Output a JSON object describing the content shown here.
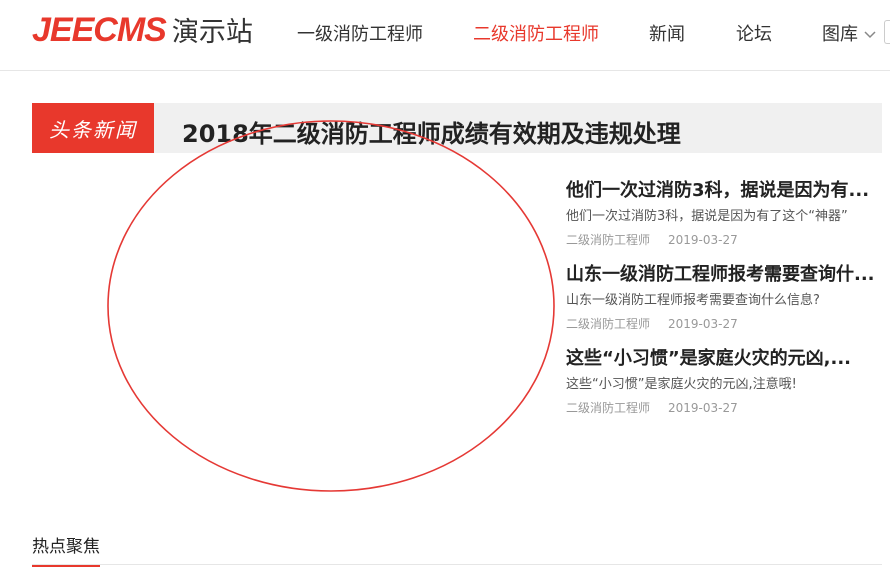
{
  "site": {
    "logo_en": "JEECMS",
    "logo_cn": "演示站",
    "accent_color": "#e8382c"
  },
  "nav": {
    "items": [
      {
        "label": "一级消防工程师",
        "active": false
      },
      {
        "label": "二级消防工程师",
        "active": true
      },
      {
        "label": "新闻",
        "active": false
      },
      {
        "label": "论坛",
        "active": false
      },
      {
        "label": "图库",
        "active": false,
        "icon": "chevron-down-icon"
      }
    ]
  },
  "headline": {
    "tag": "头条新闻",
    "title": "2018年二级消防工程师成绩有效期及违规处理"
  },
  "news": [
    {
      "title": "他们一次过消防3科，据说是因为有...",
      "desc": "他们一次过消防3科，据说是因为有了这个“神器”",
      "category": "二级消防工程师",
      "date": "2019-03-27"
    },
    {
      "title": "山东一级消防工程师报考需要查询什...",
      "desc": "山东一级消防工程师报考需要查询什么信息?",
      "category": "二级消防工程师",
      "date": "2019-03-27"
    },
    {
      "title": "这些“小习惯”是家庭火灾的元凶,...",
      "desc": "这些“小习惯”是家庭火灾的元凶,注意哦!",
      "category": "二级消防工程师",
      "date": "2019-03-27"
    }
  ],
  "section": {
    "title": "热点聚焦"
  },
  "annotation": {
    "shape": "ellipse",
    "color": "#e53935"
  }
}
